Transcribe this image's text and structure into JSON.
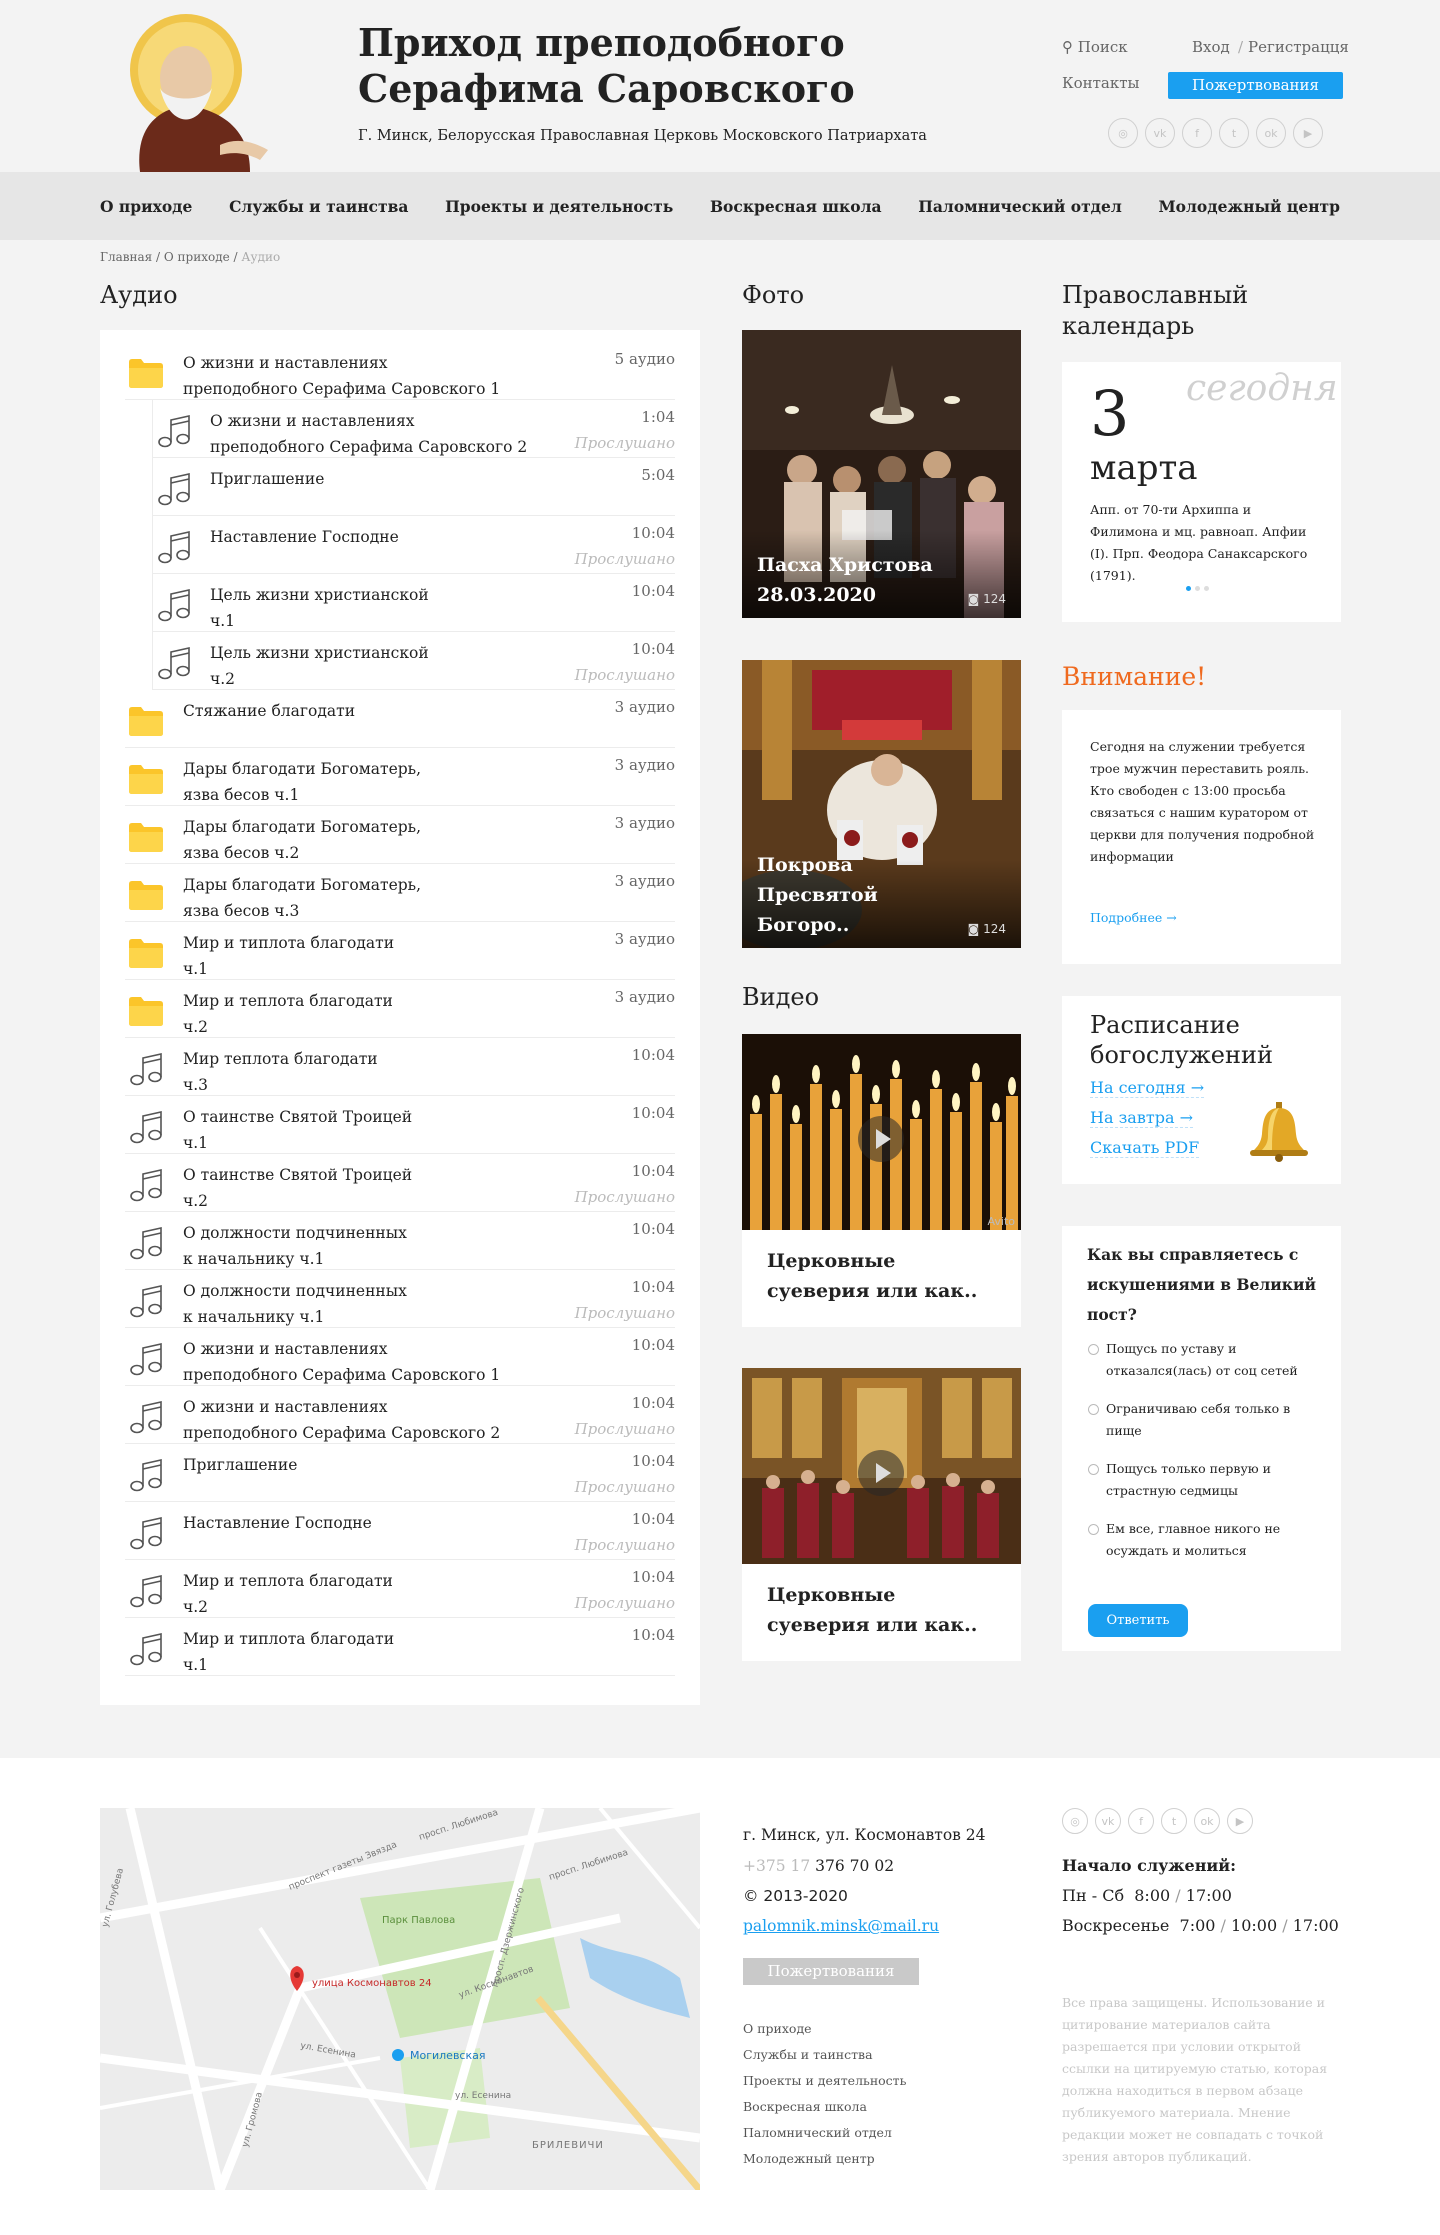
{
  "header": {
    "title_line1": "Приход преподобного",
    "title_line2": "Серафима Саровского",
    "subtitle": "Г. Минск, Белорусская Православная Церковь Московского Патриархата",
    "search_label": "Поиск",
    "login_label": "Вход",
    "slash": "/",
    "register_label": "Регистрацця",
    "contacts_label": "Контакты",
    "donate_label": "Пожертвования",
    "socials": [
      "instagram-icon",
      "vk-icon",
      "facebook-icon",
      "twitter-icon",
      "odnoklassniki-icon",
      "youtube-icon"
    ]
  },
  "nav": {
    "items": [
      {
        "label": "О приходе"
      },
      {
        "label": "Службы и таинства"
      },
      {
        "label": "Проекты и деятельность"
      },
      {
        "label": "Воскресная школа"
      },
      {
        "label": "Паломнический отдел"
      },
      {
        "label": "Молодежный центр"
      }
    ]
  },
  "breadcrumbs": {
    "home": "Главная",
    "section": "О приходе",
    "current": "Аудио",
    "sep": "/"
  },
  "audio": {
    "heading": "Аудио",
    "rows": [
      {
        "type": "folder",
        "l1": "О жизни и наставлениях",
        "l2": "преподобного Серафима Саровского 1",
        "count": "5 аудио"
      },
      {
        "type": "track",
        "sub": true,
        "l1": "О жизни и наставлениях",
        "l2": "преподобного Серафима Саровского 2",
        "dur": "1:04",
        "listened": "Прослушано"
      },
      {
        "type": "track",
        "sub": true,
        "l1": "Приглашение",
        "l2": "",
        "dur": "5:04",
        "listened": ""
      },
      {
        "type": "track",
        "sub": true,
        "l1": "Наставление Господне",
        "l2": "",
        "dur": "10:04",
        "listened": "Прослушано"
      },
      {
        "type": "track",
        "sub": true,
        "l1": "Цель жизни христианской",
        "l2": "ч.1",
        "dur": "10:04",
        "listened": ""
      },
      {
        "type": "track",
        "sub": true,
        "l1": "Цель жизни христианской",
        "l2": "ч.2",
        "dur": "10:04",
        "listened": "Прослушано"
      },
      {
        "type": "folder",
        "l1": "Стяжание благодати",
        "l2": "",
        "count": "3 аудио"
      },
      {
        "type": "folder",
        "l1": "Дары благодати Богоматерь,",
        "l2": "язва бесов ч.1",
        "count": "3 аудио"
      },
      {
        "type": "folder",
        "l1": "Дары благодати Богоматерь,",
        "l2": "язва бесов ч.2",
        "count": "3 аудио"
      },
      {
        "type": "folder",
        "l1": "Дары благодати Богоматерь,",
        "l2": "язва бесов ч.3",
        "count": "3 аудио"
      },
      {
        "type": "folder",
        "l1": "Мир и типлота благодати",
        "l2": "ч.1",
        "count": "3 аудио"
      },
      {
        "type": "folder",
        "l1": "Мир и теплота благодати",
        "l2": "ч.2",
        "count": "3 аудио"
      },
      {
        "type": "track",
        "l1": "Мир теплота благодати",
        "l2": "ч.3",
        "dur": "10:04",
        "listened": ""
      },
      {
        "type": "track",
        "l1": "О таинстве Святой Троицей",
        "l2": "ч.1",
        "dur": "10:04",
        "listened": ""
      },
      {
        "type": "track",
        "l1": "О таинстве Святой Троицей",
        "l2": "ч.2",
        "dur": "10:04",
        "listened": "Прослушано"
      },
      {
        "type": "track",
        "l1": "О должности подчиненных",
        "l2": "к начальнику ч.1",
        "dur": "10:04",
        "listened": ""
      },
      {
        "type": "track",
        "l1": "О должности подчиненных",
        "l2": "к начальнику ч.1",
        "dur": "10:04",
        "listened": "Прослушано"
      },
      {
        "type": "track",
        "l1": "О жизни и наставлениях",
        "l2": "преподобного Серафима Саровского 1",
        "dur": "10:04",
        "listened": ""
      },
      {
        "type": "track",
        "l1": "О жизни и наставлениях",
        "l2": "преподобного Серафима Саровского 2",
        "dur": "10:04",
        "listened": "Прослушано"
      },
      {
        "type": "track",
        "l1": "Приглашение",
        "l2": "",
        "dur": "10:04",
        "listened": "Прослушано"
      },
      {
        "type": "track",
        "l1": "Наставление Господне",
        "l2": "",
        "dur": "10:04",
        "listened": "Прослушано"
      },
      {
        "type": "track",
        "l1": "Мир и теплота благодати",
        "l2": "ч.2",
        "dur": "10:04",
        "listened": "Прослушано"
      },
      {
        "type": "track",
        "l1": "Мир и типлота благодати",
        "l2": "ч.1",
        "dur": "10:04",
        "listened": ""
      }
    ]
  },
  "photos": {
    "heading": "Фото",
    "items": [
      {
        "line1": "Пасха Христова",
        "line2": "28.03.2020",
        "count": "124"
      },
      {
        "line1": "Покрова",
        "line2": "Пресвятой Богоро..",
        "count": "124"
      }
    ]
  },
  "videos": {
    "heading": "Видео",
    "items": [
      {
        "line1": "Церковные",
        "line2": "суеверия или как..",
        "watermark": "Avito"
      },
      {
        "line1": "Церковные",
        "line2": "суеверия или как.."
      }
    ]
  },
  "calendar": {
    "heading_line1": "Православный",
    "heading_line2": "календарь",
    "today_label": "сегодня",
    "day": "3",
    "month": "марта",
    "text": "Апп. от 70-ти Архиппа и Филимона и мц. равноап. Апфии (I). Прп. Феодора Санаксарского (1791)."
  },
  "notice": {
    "heading": "Внимание!",
    "text": "Сегодня на служении требуется трое мужчин переставить рояль. Кто свободен с 13:00 просьба связаться с нашим куратором от церкви для получения подробной информации",
    "more_label": "Подробнее →"
  },
  "schedule": {
    "heading_line1": "Расписание",
    "heading_line2": "богослужений",
    "links": [
      "На сегодня  →",
      "На завтра  →",
      "Скачать PDF"
    ]
  },
  "poll": {
    "question": "Как вы справляетесь с искушениями в Великий пост?",
    "options": [
      "Пощусь по уставу и отказался(лась) от соц сетей",
      "Ограничиваю себя только в пище",
      "Пощусь только первую и страстную седмицы",
      "Ем все, главное никого не осуждать и молиться"
    ],
    "answer_label": "Ответить"
  },
  "footer": {
    "map_labels": {
      "street": "улица Космонавтов 24",
      "park": "Парк Павлова",
      "metro": "Могилевская",
      "district": "БРИЛЕВИЧИ",
      "roads": [
        "проспект газеты Звязда",
        "просп. Любимова",
        "ул. Космонавтов",
        "ул. Есенина",
        "ул. Голубева",
        "ул. Громова",
        "ул. Есенина",
        "просп. Дзержинского"
      ]
    },
    "address": "г. Минск, ул. Космонавтов 24",
    "phone_code": "+375 17",
    "phone": "376 70 02",
    "copyright": "©  2013-2020",
    "email": "palomnik.minsk@mail.ru",
    "donate_label": "Пожертвования",
    "links": [
      "О приходе",
      "Службы и таинства",
      "Проекты и деятельность",
      "Воскресная школа",
      "Паломнический отдел",
      "Молодежный центр"
    ],
    "services_heading": "Начало служений:",
    "weekdays_label": "Пн - Сб",
    "weekdays_times": [
      "8:00",
      "17:00"
    ],
    "sunday_label": "Воскресенье",
    "sunday_times": [
      "7:00",
      "10:00",
      "17:00"
    ],
    "rights": "Все права защищены. Использование и цитирование материалов сайта разрешается при условии открытой ссылки на цитируемую статью, которая должна находиться в первом абзаце публикуемого материала. Мнение редакции может не совпадать с точкой зрения авторов публикаций."
  },
  "colors": {
    "accent": "#1a9ff0",
    "warning": "#ef6a1f",
    "folder": "#fbc52a",
    "nav_bg": "#e6e6e6"
  }
}
